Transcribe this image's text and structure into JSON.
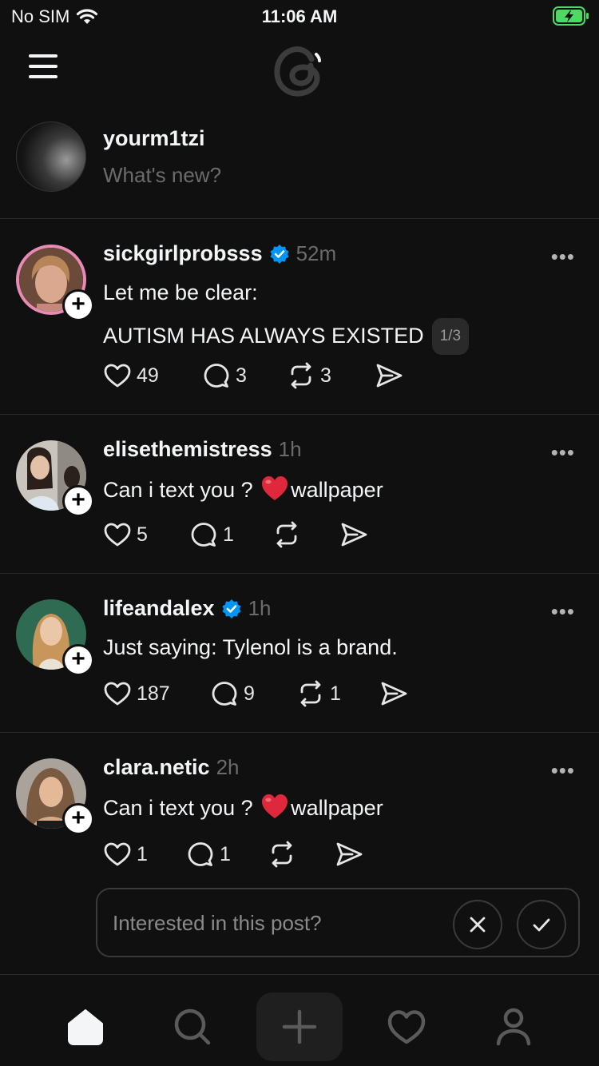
{
  "status_bar": {
    "carrier": "No SIM",
    "time": "11:06 AM"
  },
  "composer": {
    "username": "yourm1tzi",
    "placeholder": "What's new?"
  },
  "posts": [
    {
      "username": "sickgirlprobsss",
      "verified": true,
      "time": "52m",
      "lines": [
        "Let me be clear:",
        "AUTISM HAS ALWAYS EXISTED"
      ],
      "thread_counter": "1/3",
      "likes": "49",
      "replies": "3",
      "reposts": "3"
    },
    {
      "username": "elisethemistress",
      "verified": false,
      "time": "1h",
      "text_before": "Can i text you ?",
      "text_after": "wallpaper",
      "likes": "5",
      "replies": "1",
      "reposts": ""
    },
    {
      "username": "lifeandalex",
      "verified": true,
      "time": "1h",
      "text": "Just saying: Tylenol is a brand.",
      "likes": "187",
      "replies": "9",
      "reposts": "1"
    },
    {
      "username": "clara.netic",
      "verified": false,
      "time": "2h",
      "text_before": "Can i text you ?",
      "text_after": "wallpaper",
      "likes": "1",
      "replies": "1",
      "reposts": ""
    }
  ],
  "interest_prompt": {
    "text": "Interested in this post?"
  },
  "tabs": [
    "home-icon",
    "search-icon",
    "compose-icon",
    "activity-icon",
    "profile-icon"
  ],
  "colors": {
    "background": "#101010",
    "text": "#f3f5f7",
    "muted": "#6b6b6b",
    "verified": "#0095f6",
    "battery": "#4cd964",
    "heart_emoji": "#e0283c"
  }
}
